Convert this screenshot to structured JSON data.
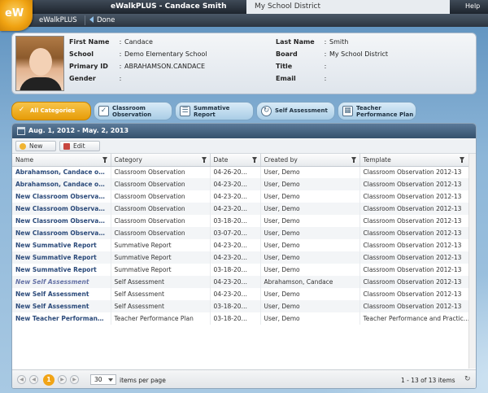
{
  "app": {
    "title": "eWalkPLUS - Candace Smith",
    "district": "My School District",
    "help": "Help",
    "name": "eWalkPLUS",
    "done": "Done",
    "logo_text": "eW"
  },
  "profile": {
    "first_name_label": "First Name",
    "first_name": "Candace",
    "school_label": "School",
    "school": "Demo Elementary School",
    "primary_id_label": "Primary ID",
    "primary_id": "ABRAHAMSON.CANDACE",
    "gender_label": "Gender",
    "gender": "",
    "last_name_label": "Last Name",
    "last_name": "Smith",
    "board_label": "Board",
    "board": "My School District",
    "title_label": "Title",
    "title": "",
    "email_label": "Email",
    "email": "",
    "colon": ":"
  },
  "categories": [
    {
      "label": "All Categories",
      "icon": "check-icon"
    },
    {
      "label": "Classroom\nObservation",
      "icon": "checklist-icon"
    },
    {
      "label": "Summative\nReport",
      "icon": "report-icon"
    },
    {
      "label": "Self Assessment",
      "icon": "cycle-icon"
    },
    {
      "label": "Teacher\nPerformance Plan",
      "icon": "plan-icon"
    }
  ],
  "panel": {
    "date_range": "Aug. 1, 2012 - May. 2, 2013",
    "new_label": "New",
    "edit_label": "Edit"
  },
  "table": {
    "columns": [
      "Name",
      "Category",
      "Date",
      "Created by",
      "Template"
    ],
    "rows": [
      [
        "Abrahamson, Candace on A...",
        "Classroom Observation",
        "04-26-2013",
        "User, Demo",
        "Classroom Observation 2012-13"
      ],
      [
        "Abrahamson, Candace on A...",
        "Classroom Observation",
        "04-23-2013",
        "User, Demo",
        "Classroom Observation 2012-13"
      ],
      [
        "New Classroom Observation",
        "Classroom Observation",
        "04-23-2013",
        "User, Demo",
        "Classroom Observation 2012-13"
      ],
      [
        "New Classroom Observation",
        "Classroom Observation",
        "04-23-2013",
        "User, Demo",
        "Classroom Observation 2012-13"
      ],
      [
        "New Classroom Observation",
        "Classroom Observation",
        "03-18-2013",
        "User, Demo",
        "Classroom Observation 2012-13"
      ],
      [
        "New Classroom Observation",
        "Classroom Observation",
        "03-07-2013",
        "User, Demo",
        "Classroom Observation 2012-13"
      ],
      [
        "New Summative Report",
        "Summative Report",
        "04-23-2013",
        "User, Demo",
        "Classroom Observation 2012-13"
      ],
      [
        "New Summative Report",
        "Summative Report",
        "04-23-2013",
        "User, Demo",
        "Classroom Observation 2012-13"
      ],
      [
        "New Summative Report",
        "Summative Report",
        "03-18-2013",
        "User, Demo",
        "Classroom Observation 2012-13"
      ],
      [
        "New Self Assessment",
        "Self Assessment",
        "04-23-2013",
        "Abrahamson, Candace",
        "Classroom Observation 2012-13"
      ],
      [
        "New Self Assessment",
        "Self Assessment",
        "04-23-2013",
        "User, Demo",
        "Classroom Observation 2012-13"
      ],
      [
        "New Self Assessment",
        "Self Assessment",
        "03-18-2013",
        "User, Demo",
        "Classroom Observation 2012-13"
      ],
      [
        "New Teacher Performance ...",
        "Teacher Performance Plan",
        "03-18-2013",
        "User, Demo",
        "Teacher Performance and Practice ..."
      ]
    ]
  },
  "pager": {
    "current_page": "1",
    "page_size": "30",
    "page_size_label": "items per page",
    "info": "1 - 13 of 13 items"
  },
  "colors": {
    "accent": "#f1a416",
    "header": "#34506c",
    "link": "#2b4a7a"
  }
}
